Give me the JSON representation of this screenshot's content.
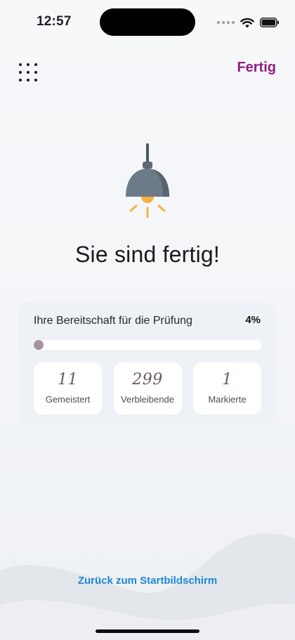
{
  "status_bar": {
    "time": "12:57",
    "icons": [
      "cellular-signal-icon",
      "wifi-icon",
      "battery-icon"
    ]
  },
  "nav": {
    "menu_icon": "grid-menu-icon",
    "done_label": "Fertig"
  },
  "hero": {
    "icon": "hanging-lamp-icon",
    "title": "Sie sind fertig!"
  },
  "readiness": {
    "label": "Ihre Bereitschaft für die Prüfung",
    "percent_text": "4%",
    "progress_fraction": 0.04,
    "stats": [
      {
        "value": "11",
        "label": "Gemeistert"
      },
      {
        "value": "299",
        "label": "Verbleibende"
      },
      {
        "value": "1",
        "label": "Markierte"
      }
    ]
  },
  "footer": {
    "back_label": "Zurück zum Startbildschirm"
  },
  "colors": {
    "accent_done": "#8e1f86",
    "link_blue": "#1b88d2",
    "progress_fill": "#a891a3",
    "stat_value": "#6b5963",
    "lamp_shade": "#6d7a87",
    "lamp_bulb": "#f6b23c"
  }
}
